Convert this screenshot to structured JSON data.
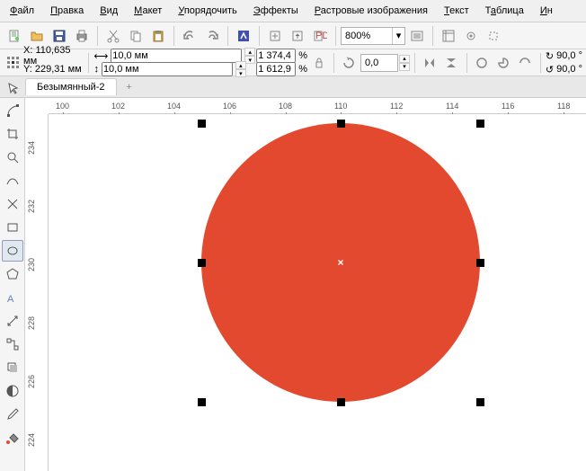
{
  "menu": {
    "file": "Файл",
    "edit": "Правка",
    "view": "Вид",
    "layout": "Макет",
    "arrange": "Упорядочить",
    "effects": "Эффекты",
    "bitmaps": "Растровые изображения",
    "text": "Текст",
    "table": "Таблица",
    "tools": "Ин"
  },
  "zoom": {
    "value": "800%"
  },
  "property": {
    "x_label": "X:",
    "x_value": "110,635 мм",
    "y_label": "Y:",
    "y_value": "229,31 мм",
    "w_value": "10,0 мм",
    "h_value": "10,0 мм",
    "sx_value": "1 374,4",
    "sx_unit": "%",
    "sy_value": "1 612,9",
    "sy_unit": "%",
    "rotation": "0,0",
    "angle1": "90,0",
    "angle2": "90,0",
    "deg": "°"
  },
  "tab": {
    "name": "Безымянный-2"
  },
  "ruler_h": [
    "100",
    "102",
    "104",
    "106",
    "108",
    "110",
    "112",
    "114",
    "116",
    "118"
  ],
  "ruler_v": [
    "234",
    "232",
    "230",
    "228",
    "226",
    "224"
  ],
  "colors": {
    "shape_fill": "#e2492e"
  }
}
